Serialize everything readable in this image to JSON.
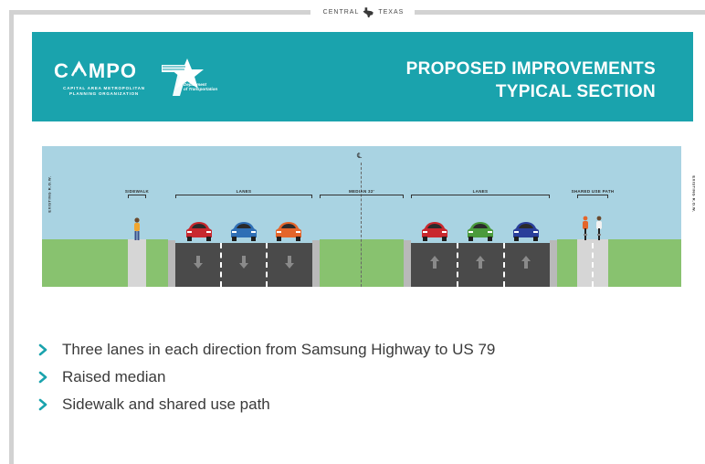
{
  "header": {
    "brand_left": "CENTRAL",
    "brand_right": "TEXAS"
  },
  "banner": {
    "campo_logo_text": "C MPO",
    "campo_subtitle_line1": "CAPITAL AREA METROPOLITAN",
    "campo_subtitle_line2": "PLANNING ORGANIZATION",
    "txdot_line1": "Texas",
    "txdot_line2": "Department",
    "txdot_line3": "of Transportation",
    "title_line1": "PROPOSED IMPROVEMENTS",
    "title_line2": "TYPICAL SECTION",
    "color": "#1aa3ad"
  },
  "diagram": {
    "row_left": "EXISTING R.O.W.",
    "row_right": "EXISTING R.O.W.",
    "centerline_symbol": "℄",
    "segments": {
      "sidewalk": "SIDEWALK",
      "lanes_left": "LANES",
      "median": "MEDIAN 32'",
      "lanes_right": "LANES",
      "shared_use_path": "SHARED USE PATH"
    },
    "colors": {
      "sky": "#a9d3e2",
      "grass": "#88c26f",
      "road": "#4a4a4a",
      "car_red": "#c8282e",
      "car_blue": "#2f6fb5",
      "car_orange": "#e4652a",
      "car_green": "#4a9a3c",
      "car_navy": "#2a3f9a"
    }
  },
  "bullets": [
    "Three lanes in each direction from Samsung Highway to US 79",
    "Raised median",
    "Sidewalk and shared use path"
  ],
  "accent_color": "#1aa3ad"
}
